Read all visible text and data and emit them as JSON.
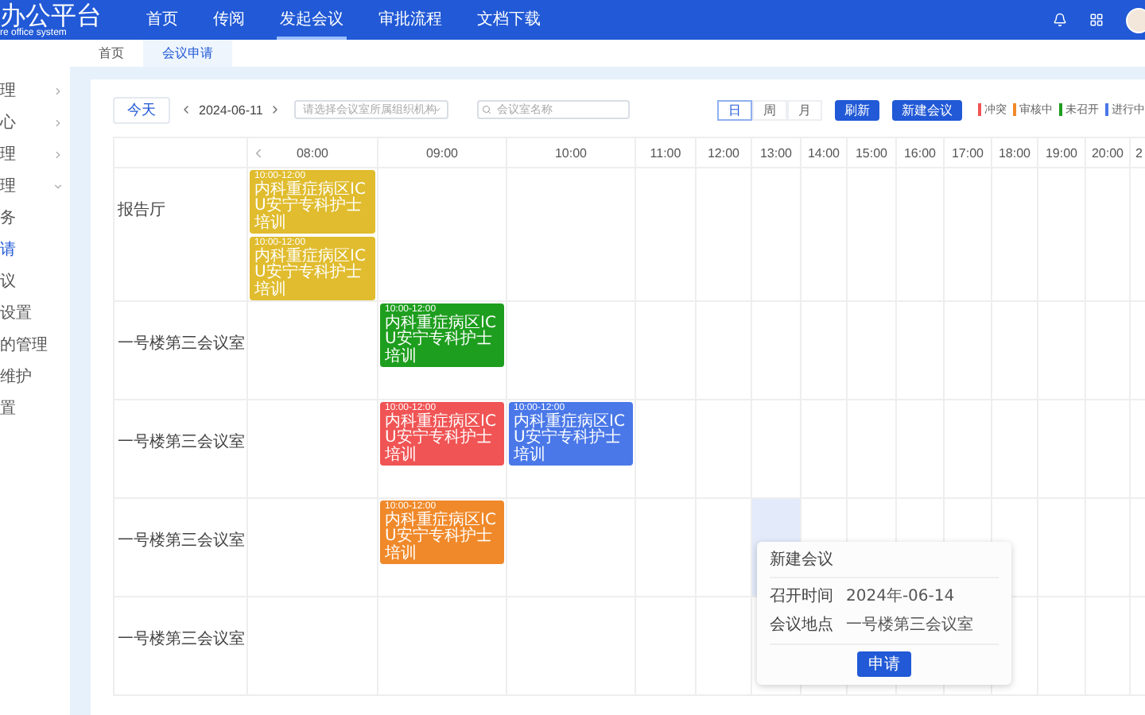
{
  "header": {
    "logo": "办公平台",
    "subtitle": "re office system",
    "nav": [
      {
        "label": "首页",
        "selected": false
      },
      {
        "label": "传阅",
        "selected": false
      },
      {
        "label": "发起会议",
        "selected": true
      },
      {
        "label": "审批流程",
        "selected": false
      },
      {
        "label": "文档下载",
        "selected": false
      }
    ]
  },
  "tabs": [
    {
      "label": "首页",
      "selected": false
    },
    {
      "label": "会议申请",
      "selected": true
    }
  ],
  "sidebar": {
    "items": [
      {
        "label": "理",
        "expanded": false,
        "selected": false
      },
      {
        "label": "心",
        "expanded": false,
        "selected": false
      },
      {
        "label": "理",
        "expanded": false,
        "selected": false
      },
      {
        "label": "理",
        "expanded": true,
        "selected": false,
        "children": [
          {
            "label": "务",
            "selected": false
          },
          {
            "label": "请",
            "selected": true
          },
          {
            "label": "议",
            "selected": false
          },
          {
            "label": "设置",
            "selected": false
          },
          {
            "label": "的管理",
            "selected": false
          },
          {
            "label": "维护",
            "selected": false
          }
        ]
      },
      {
        "label": "置",
        "selected": false
      }
    ]
  },
  "toolbar": {
    "today": "今天",
    "date": "2024-06-11",
    "org_select": {
      "placeholder": "请选择会议室所属组织机构"
    },
    "search": {
      "placeholder": "会议室名称"
    },
    "views": [
      {
        "label": "日",
        "selected": true
      },
      {
        "label": "周",
        "selected": false
      },
      {
        "label": "月",
        "selected": false
      }
    ],
    "buttons": [
      "刷新",
      "新建会议"
    ],
    "legend": [
      {
        "label": "冲突",
        "color": "#f05454"
      },
      {
        "label": "审核中",
        "color": "#f0892a"
      },
      {
        "label": "未召开",
        "color": "#1e9e1e"
      },
      {
        "label": "进行中",
        "color": "#4a78e8"
      }
    ]
  },
  "schedule": {
    "columns": [
      "08:00",
      "09:00",
      "10:00",
      "11:00",
      "12:00",
      "13:00",
      "14:00",
      "15:00",
      "16:00",
      "17:00",
      "18:00",
      "19:00",
      "20:00",
      "2"
    ],
    "rooms": [
      {
        "name": "报告厅",
        "cells": [
          {
            "selected": false,
            "events": [
              {
                "time": "10:00-12:00",
                "title": "内科重症病区ICU安宁专科护士培训",
                "color": "#e0bc2e"
              },
              {
                "time": "10:00-12:00",
                "title": "内科重症病区ICU安宁专科护士培训",
                "color": "#e0bc2e"
              }
            ]
          },
          {
            "selected": false
          },
          {
            "selected": false
          },
          {
            "selected": false
          },
          {
            "selected": false
          },
          {
            "selected": false
          },
          {
            "selected": false
          },
          {
            "selected": false
          },
          {
            "selected": false
          },
          {
            "selected": false
          },
          {
            "selected": false
          },
          {
            "selected": false
          },
          {
            "selected": false
          },
          {
            "selected": false
          }
        ]
      },
      {
        "name": "一号楼第三会议室",
        "cells": [
          {
            "selected": false
          },
          {
            "selected": false,
            "events": [
              {
                "time": "10:00-12:00",
                "title": "内科重症病区ICU安宁专科护士培训",
                "color": "#1e9e1e"
              }
            ]
          },
          {
            "selected": false
          },
          {
            "selected": false
          },
          {
            "selected": false
          },
          {
            "selected": false
          },
          {
            "selected": false
          },
          {
            "selected": false
          },
          {
            "selected": false
          },
          {
            "selected": false
          },
          {
            "selected": false
          },
          {
            "selected": false
          },
          {
            "selected": false
          },
          {
            "selected": false
          }
        ]
      },
      {
        "name": "一号楼第三会议室",
        "cells": [
          {
            "selected": false
          },
          {
            "selected": false,
            "events": [
              {
                "time": "10:00-12:00",
                "title": "内科重症病区ICU安宁专科护士培训",
                "color": "#f05454"
              }
            ]
          },
          {
            "selected": false,
            "events": [
              {
                "time": "10:00-12:00",
                "title": "内科重症病区ICU安宁专科护士培训",
                "color": "#4a78e8"
              }
            ]
          },
          {
            "selected": false
          },
          {
            "selected": false
          },
          {
            "selected": false
          },
          {
            "selected": false
          },
          {
            "selected": false
          },
          {
            "selected": false
          },
          {
            "selected": false
          },
          {
            "selected": false
          },
          {
            "selected": false
          },
          {
            "selected": false
          },
          {
            "selected": false
          }
        ]
      },
      {
        "name": "一号楼第三会议室",
        "cells": [
          {
            "selected": false
          },
          {
            "selected": false,
            "events": [
              {
                "time": "10:00-12:00",
                "title": "内科重症病区ICU安宁专科护士培训",
                "color": "#f0892a"
              }
            ]
          },
          {
            "selected": false
          },
          {
            "selected": false
          },
          {
            "selected": false
          },
          {
            "selected": true
          },
          {
            "selected": false
          },
          {
            "selected": false
          },
          {
            "selected": false
          },
          {
            "selected": false
          },
          {
            "selected": false
          },
          {
            "selected": false
          },
          {
            "selected": false
          },
          {
            "selected": false
          }
        ]
      },
      {
        "name": "一号楼第三会议室",
        "cells": [
          {
            "selected": false
          },
          {
            "selected": false
          },
          {
            "selected": false
          },
          {
            "selected": false
          },
          {
            "selected": false
          },
          {
            "selected": false
          },
          {
            "selected": false
          },
          {
            "selected": false
          },
          {
            "selected": false
          },
          {
            "selected": false
          },
          {
            "selected": false
          },
          {
            "selected": false
          },
          {
            "selected": false
          },
          {
            "selected": false
          }
        ]
      }
    ]
  },
  "popup": {
    "title": "新建会议",
    "fields": [
      {
        "label": "召开时间",
        "value": "2024年-06-14"
      },
      {
        "label": "会议地点",
        "value": "一号楼第三会议室"
      }
    ],
    "button": "申请"
  }
}
